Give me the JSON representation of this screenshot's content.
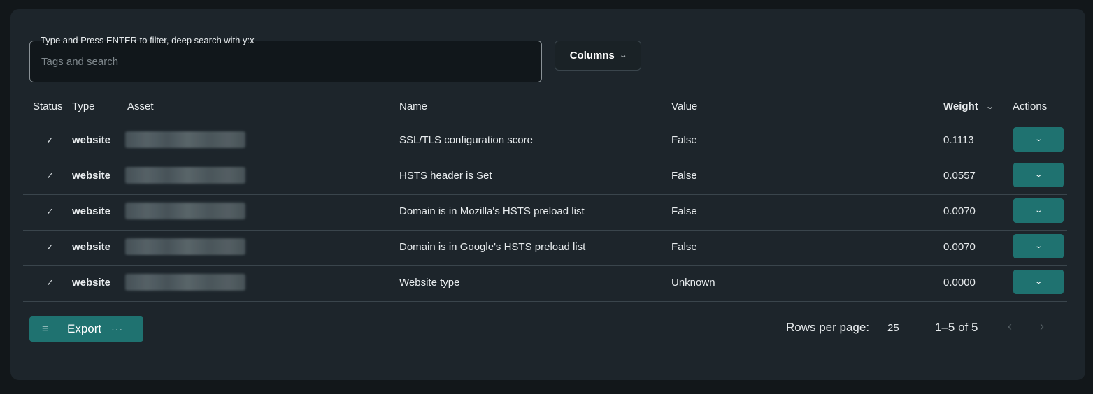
{
  "search": {
    "legend": "Type and Press ENTER to filter, deep search with y:x",
    "placeholder": "Tags and search"
  },
  "columns_button": {
    "label": "Columns"
  },
  "table": {
    "headers": {
      "status": "Status",
      "type": "Type",
      "asset": "Asset",
      "name": "Name",
      "value": "Value",
      "weight": "Weight",
      "actions": "Actions"
    },
    "rows": [
      {
        "status": "✓",
        "type": "website",
        "name": "SSL/TLS configuration score",
        "value": "False",
        "weight": "0.1113"
      },
      {
        "status": "✓",
        "type": "website",
        "name": "HSTS header is Set",
        "value": "False",
        "weight": "0.0557"
      },
      {
        "status": "✓",
        "type": "website",
        "name": "Domain is in Mozilla's HSTS preload list",
        "value": "False",
        "weight": "0.0070"
      },
      {
        "status": "✓",
        "type": "website",
        "name": "Domain is in Google's HSTS preload list",
        "value": "False",
        "weight": "0.0070"
      },
      {
        "status": "✓",
        "type": "website",
        "name": "Website type",
        "value": "Unknown",
        "weight": "0.0000"
      }
    ]
  },
  "footer": {
    "export_label": "Export",
    "rows_per_page_label": "Rows per page:",
    "rows_per_page_value": "25",
    "range_label": "1–5 of 5"
  },
  "icons": {
    "chevron": "chevron-down-icon",
    "export": "list-export-icon",
    "more": "more-horizontal-icon",
    "prev": "chevron-left-icon",
    "next": "chevron-right-icon"
  },
  "colors": {
    "accent": "#1f7270",
    "panel": "#1d252b",
    "page": "#12171a"
  }
}
